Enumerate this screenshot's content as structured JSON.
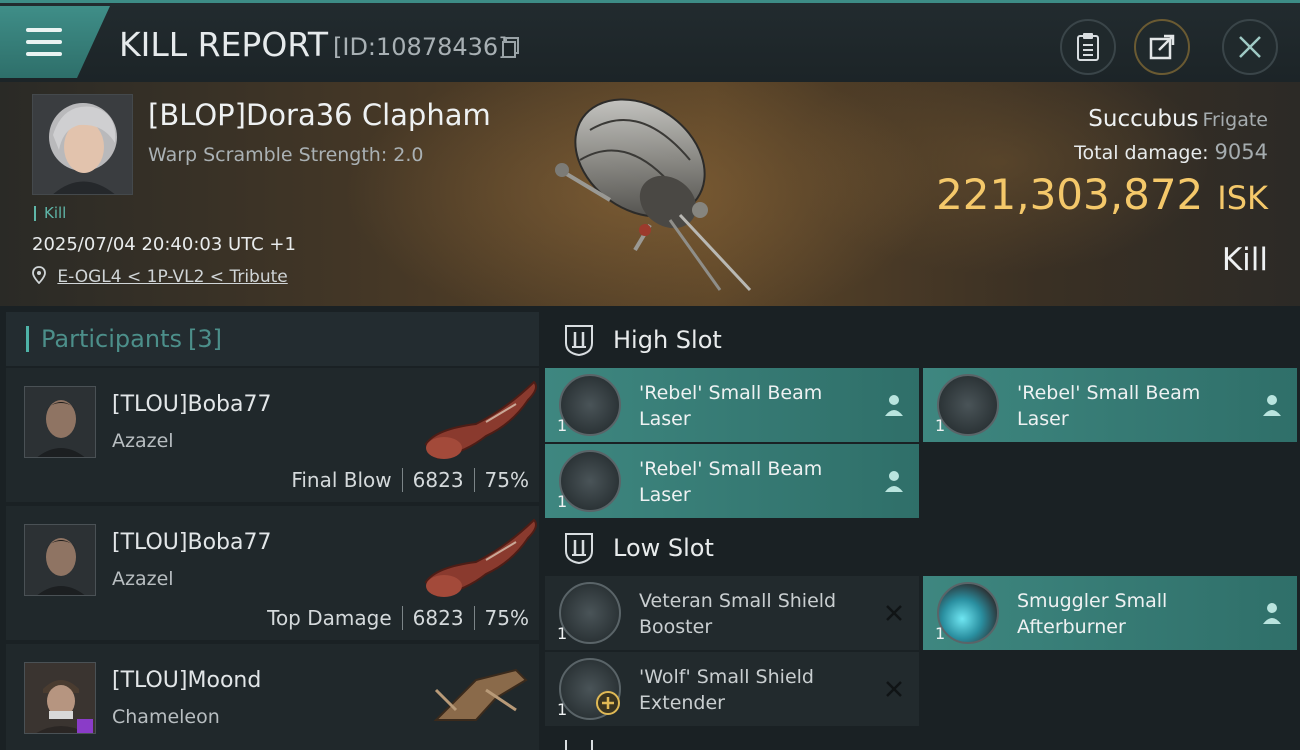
{
  "header": {
    "title": "KILL REPORT",
    "report_id": "[ID:10878436]"
  },
  "victim": {
    "name": "[BLOP]Dora36 Clapham",
    "subtitle": "Warp Scramble Strength: 2.0",
    "tag": "Kill",
    "datetime": "2025/07/04 20:40:03 UTC +1",
    "location": "E-OGL4 < 1P-VL2 < Tribute",
    "ship_name": "Succubus",
    "ship_class": "Frigate",
    "total_damage_label": "Total damage:",
    "total_damage": "9054",
    "isk_value": "221,303,872",
    "isk_unit": "ISK",
    "result": "Kill"
  },
  "participants": {
    "label": "Participants",
    "count": "[3]",
    "items": [
      {
        "name": "[TLOU]Boba77",
        "ship": "Azazel",
        "role": "Final Blow",
        "damage": "6823",
        "percent": "75%"
      },
      {
        "name": "[TLOU]Boba77",
        "ship": "Azazel",
        "role": "Top Damage",
        "damage": "6823",
        "percent": "75%"
      },
      {
        "name": "[TLOU]Moond",
        "ship": "Chameleon"
      }
    ]
  },
  "fitting": {
    "high_slot": {
      "label": "High Slot",
      "modules": [
        {
          "qty": "1",
          "name": "'Rebel' Small Beam Laser",
          "state_icon": "person-icon"
        },
        {
          "qty": "1",
          "name": "'Rebel' Small Beam Laser",
          "state_icon": "person-icon"
        },
        {
          "qty": "1",
          "name": "'Rebel' Small Beam Laser",
          "state_icon": "person-icon"
        }
      ]
    },
    "low_slot": {
      "label": "Low Slot",
      "modules": [
        {
          "qty": "1",
          "name": "Veteran Small Shield Booster",
          "state_icon": "destroyed-x-icon"
        },
        {
          "qty": "1",
          "name": "Smuggler Small Afterburner",
          "state_icon": "person-icon"
        },
        {
          "qty": "1",
          "name": "'Wolf' Small Shield Extender",
          "state_icon": "destroyed-x-icon"
        }
      ]
    }
  },
  "colors": {
    "accent_teal": "#3e8780",
    "isk_gold": "#f4c86a"
  }
}
